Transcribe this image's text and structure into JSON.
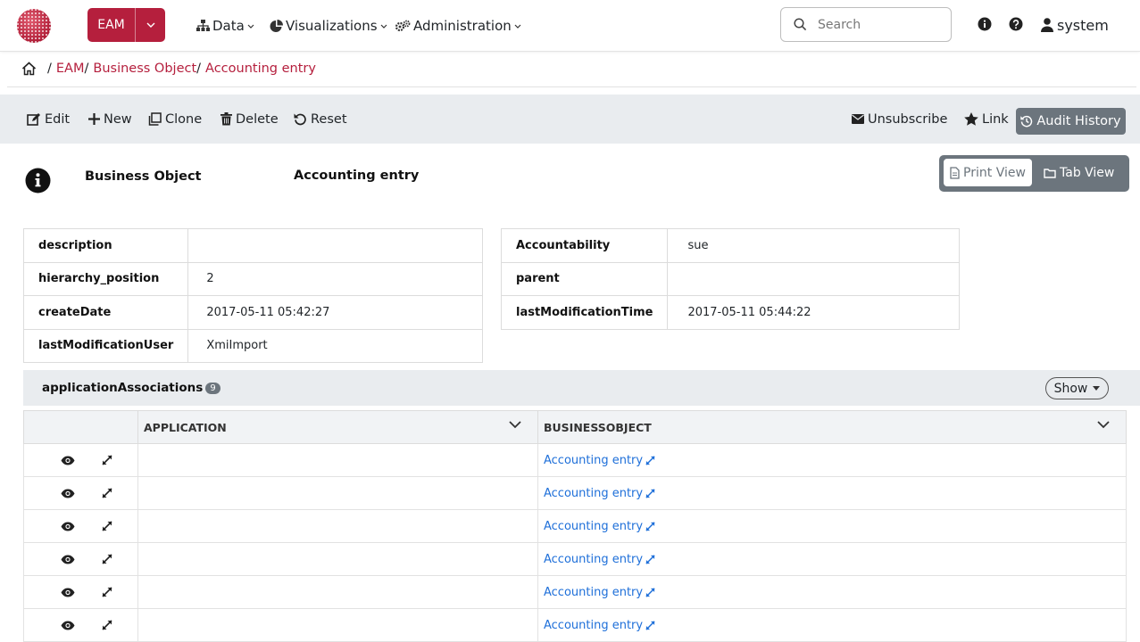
{
  "app": {
    "title": "EAM"
  },
  "nav": {
    "menus": [
      {
        "label": "Data",
        "icon": "sitemap-icon"
      },
      {
        "label": "Visualizations",
        "icon": "chart-pie-icon"
      },
      {
        "label": "Administration",
        "icon": "cogs-icon"
      }
    ],
    "search_placeholder": "Search",
    "user": "system"
  },
  "breadcrumb": {
    "items": [
      "EAM",
      "Business Object",
      "Accounting entry"
    ]
  },
  "actions": {
    "edit": "Edit",
    "new": "New",
    "clone": "Clone",
    "delete": "Delete",
    "reset": "Reset",
    "unsubscribe": "Unsubscribe",
    "link": "Link",
    "audit_history": "Audit History"
  },
  "header": {
    "type_label": "Business Object",
    "name": "Accounting entry",
    "print_view": "Print View",
    "tab_view": "Tab View"
  },
  "properties": {
    "left": [
      {
        "key": "description",
        "value": ""
      },
      {
        "key": "hierarchy_position",
        "value": "2"
      },
      {
        "key": "createDate",
        "value": "2017-05-11 05:42:27"
      },
      {
        "key": "lastModificationUser",
        "value": "XmiImport"
      }
    ],
    "right": [
      {
        "key": "Accountability",
        "value": "sue"
      },
      {
        "key": "parent",
        "value": ""
      },
      {
        "key": "lastModificationTime",
        "value": "2017-05-11 05:44:22"
      }
    ]
  },
  "associations": {
    "title": "applicationAssociations",
    "count": "9",
    "show_label": "Show",
    "columns": [
      "APPLICATION",
      "BUSINESSOBJECT"
    ],
    "rows": [
      {
        "application": "",
        "businessobject": "Accounting entry"
      },
      {
        "application": "",
        "businessobject": "Accounting entry"
      },
      {
        "application": "",
        "businessobject": "Accounting entry"
      },
      {
        "application": "",
        "businessobject": "Accounting entry"
      },
      {
        "application": "",
        "businessobject": "Accounting entry"
      },
      {
        "application": "",
        "businessobject": "Accounting entry"
      }
    ]
  },
  "colors": {
    "brand": "#b51f3d",
    "link": "#1e6fd9",
    "toolbar_bg": "#e9ecef",
    "secondary": "#6c757d"
  }
}
